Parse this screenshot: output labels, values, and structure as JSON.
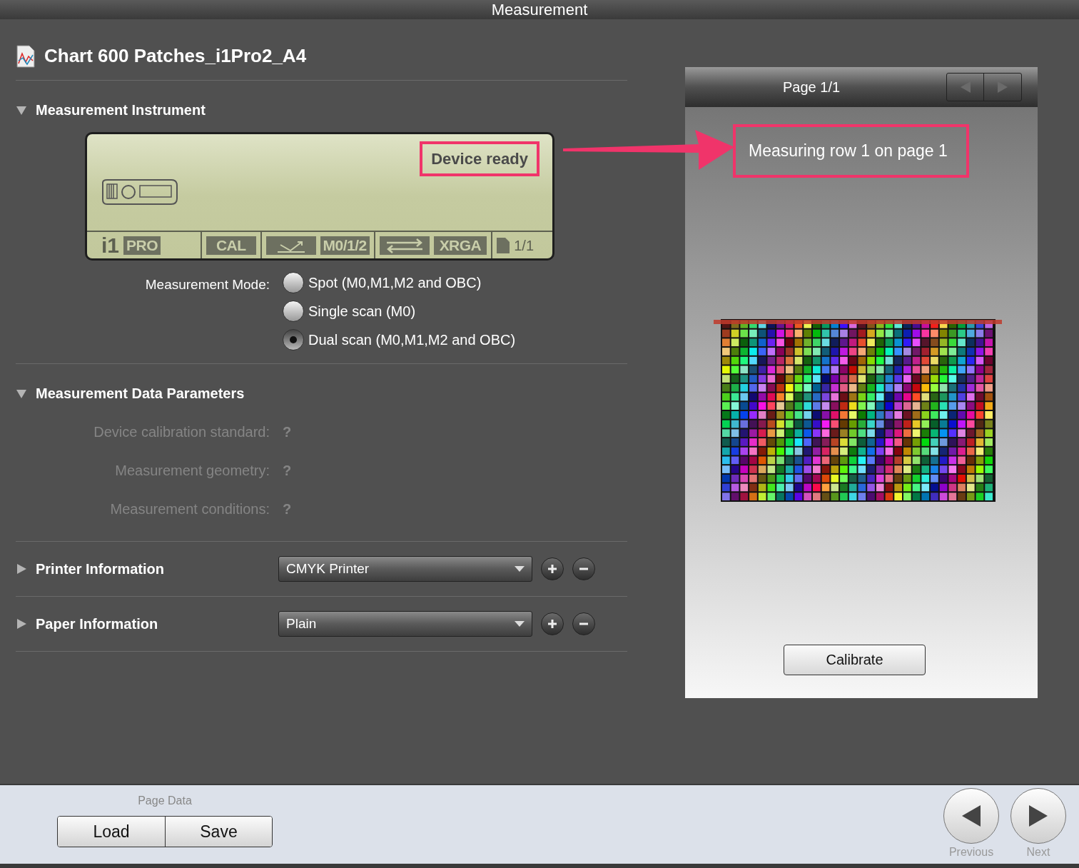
{
  "window": {
    "title": "Measurement"
  },
  "chart_name": "Chart 600 Patches_i1Pro2_A4",
  "instrument": {
    "title": "Measurement Instrument",
    "expanded": true,
    "device": {
      "status": "Device ready",
      "brand": "i1",
      "model": "PRO",
      "calibration": "CAL",
      "mode": "M0/1/2",
      "standard": "XRGA",
      "pages": "1/1"
    },
    "mode_label": "Measurement Mode:",
    "modes": [
      {
        "label": "Spot (M0,M1,M2 and OBC)",
        "selected": false
      },
      {
        "label": "Single scan (M0)",
        "selected": false
      },
      {
        "label": "Dual scan (M0,M1,M2 and OBC)",
        "selected": true
      }
    ]
  },
  "data_parameters": {
    "title": "Measurement Data Parameters",
    "expanded": true,
    "rows": [
      {
        "label": "Device calibration standard:",
        "value": "?",
        "disabled": true
      },
      {
        "label": "Measurement geometry:",
        "value": "?",
        "disabled": true
      },
      {
        "label": "Measurement conditions:",
        "value": "?",
        "disabled": true
      }
    ]
  },
  "printer": {
    "title": "Printer Information",
    "expanded": false,
    "value": "CMYK Printer"
  },
  "paper": {
    "title": "Paper Information",
    "expanded": false,
    "value": "Plain"
  },
  "preview": {
    "page": "Page 1/1",
    "message": "Measuring row 1 on page 1",
    "calibrate": "Calibrate"
  },
  "footer": {
    "label": "Page Data",
    "buttons": [
      "Load",
      "Save"
    ],
    "nav": [
      {
        "kind": "previous",
        "label": "Previous"
      },
      {
        "kind": "next",
        "label": "Next"
      }
    ]
  }
}
